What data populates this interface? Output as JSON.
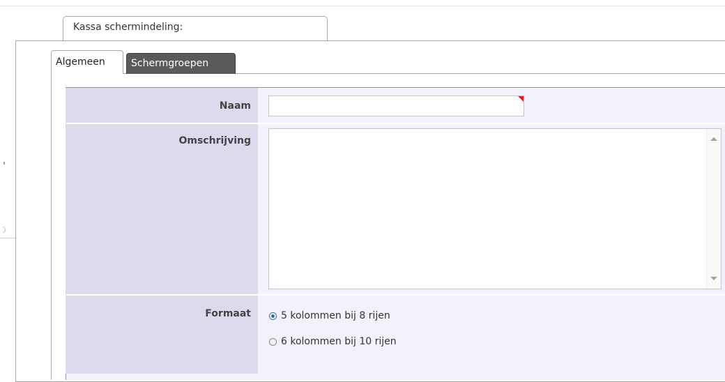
{
  "window": {
    "title": "Kassa schermindeling:"
  },
  "tabs": [
    {
      "label": "Algemeen",
      "active": true
    },
    {
      "label": "Schermgroepen",
      "active": false
    }
  ],
  "form": {
    "naam": {
      "label": "Naam",
      "value": "",
      "required": true
    },
    "omschrijving": {
      "label": "Omschrijving",
      "value": ""
    },
    "formaat": {
      "label": "Formaat",
      "options": [
        {
          "label": "5 kolommen bij 8 rijen",
          "selected": true
        },
        {
          "label": "6 kolommen bij 10 rijen",
          "selected": false
        }
      ]
    }
  },
  "colors": {
    "label_column": "#dcdbeb",
    "field_area": "#f3f2fa",
    "active_tab": "#ffffff",
    "inactive_tab": "#5a5a5a",
    "required_flag": "#e8201a"
  }
}
